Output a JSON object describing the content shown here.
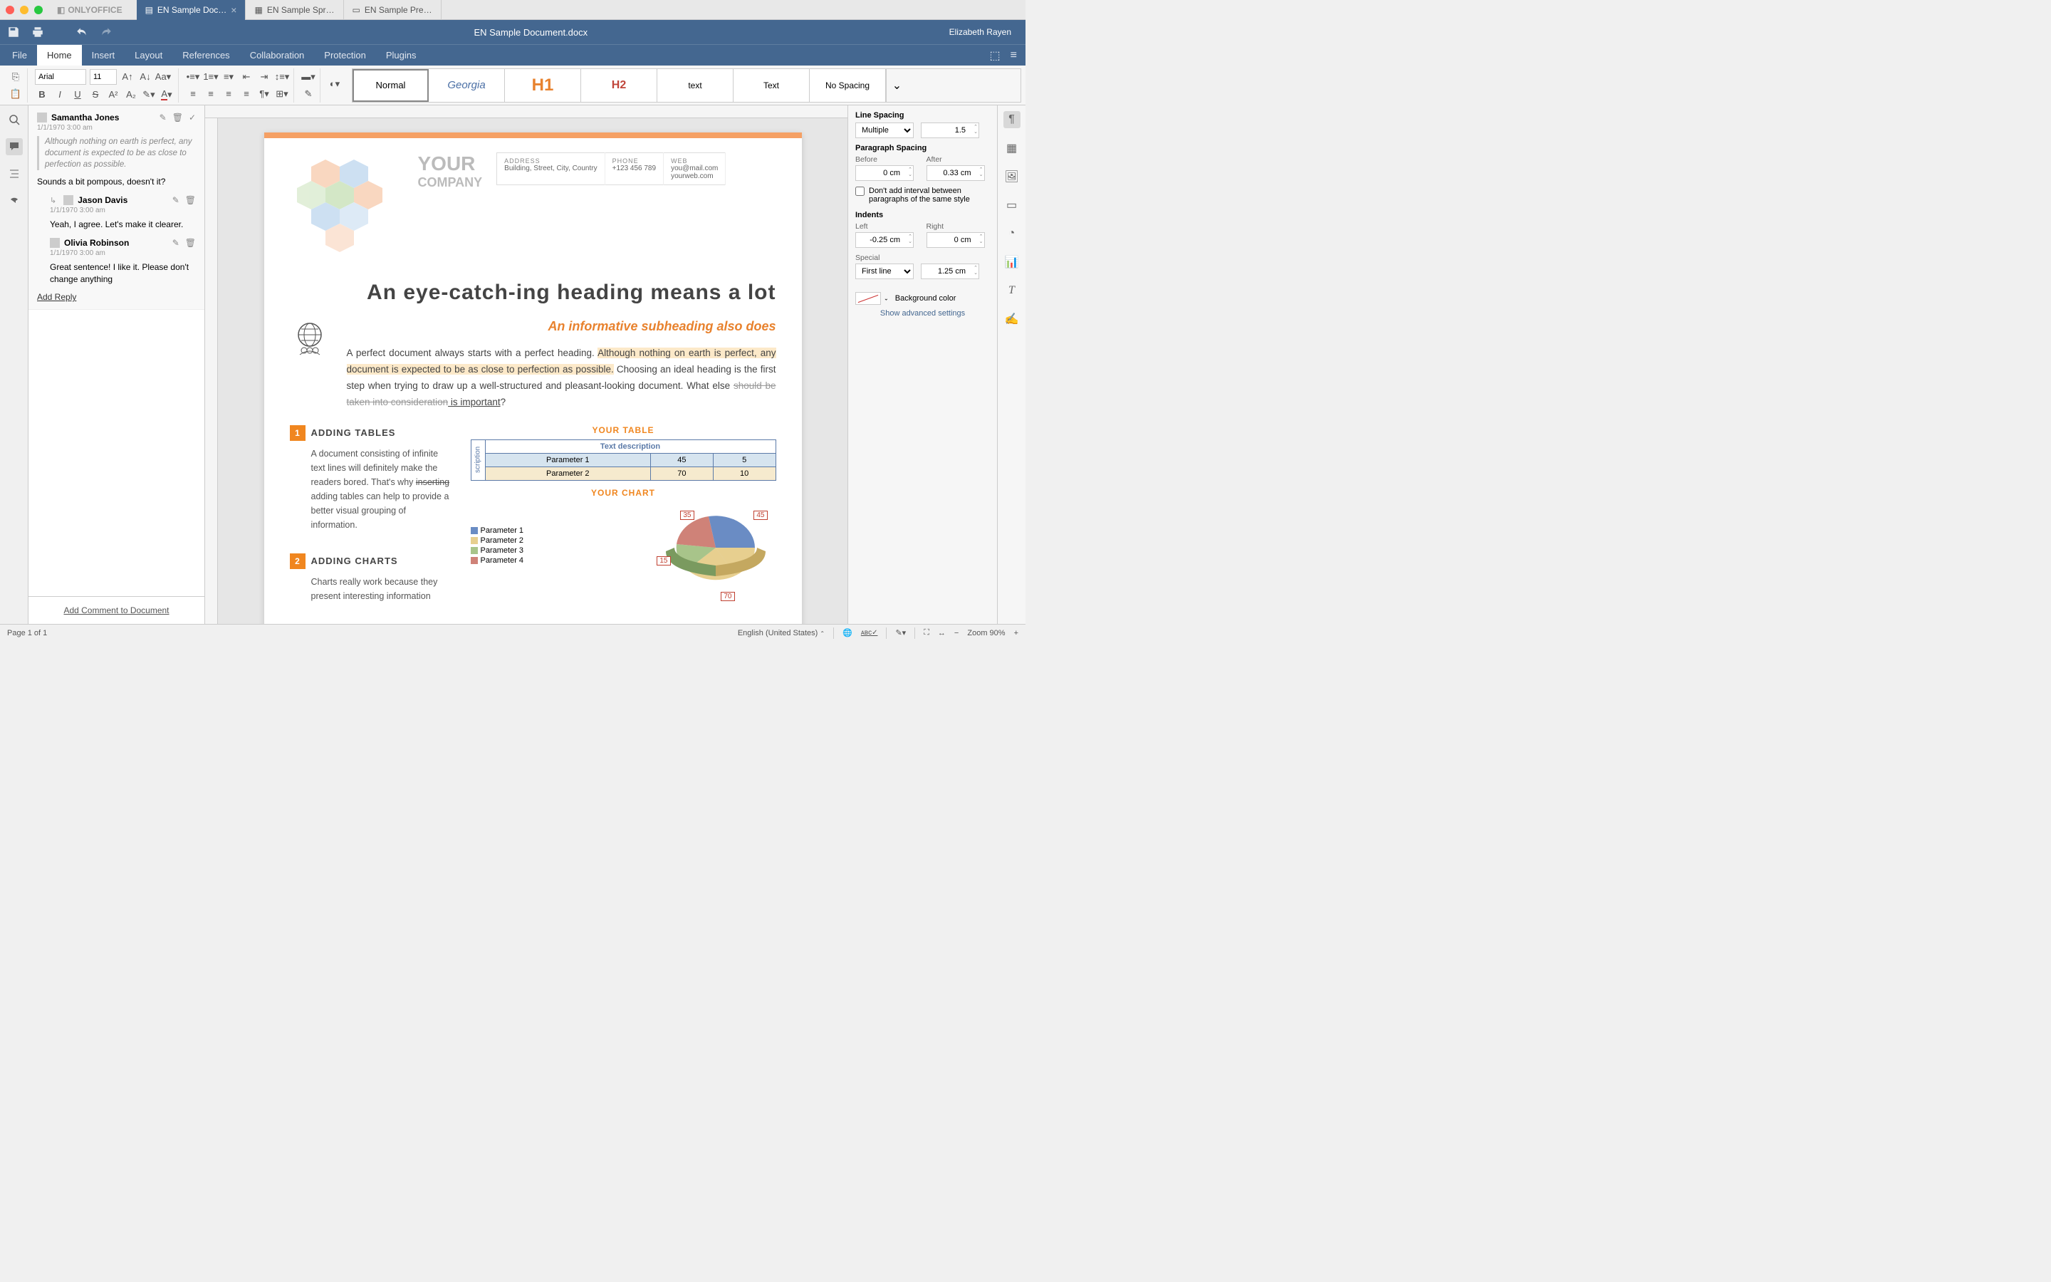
{
  "app_name": "ONLYOFFICE",
  "tabs": [
    {
      "label": "EN Sample Doc…",
      "active": true
    },
    {
      "label": "EN Sample Spr…",
      "active": false
    },
    {
      "label": "EN Sample Pre…",
      "active": false
    }
  ],
  "doc_title": "EN Sample Document.docx",
  "user": "Elizabeth Rayen",
  "menu": [
    "File",
    "Home",
    "Insert",
    "Layout",
    "References",
    "Collaboration",
    "Protection",
    "Plugins"
  ],
  "active_menu": "Home",
  "font": {
    "name": "Arial",
    "size": "11"
  },
  "styles": [
    {
      "label": "Normal",
      "class": ""
    },
    {
      "label": "Georgia",
      "class": "style-georgia"
    },
    {
      "label": "H1",
      "class": "style-h1"
    },
    {
      "label": "H2",
      "class": "style-h2"
    },
    {
      "label": "text",
      "class": ""
    },
    {
      "label": "Text",
      "class": ""
    },
    {
      "label": "No Spacing",
      "class": ""
    }
  ],
  "comments": {
    "main": {
      "author": "Samantha Jones",
      "time": "1/1/1970 3:00 am",
      "quote": "Although nothing on earth is perfect, any document is expected to be as close to perfection as possible.",
      "text": "Sounds a bit pompous, doesn't it?"
    },
    "replies": [
      {
        "author": "Jason Davis",
        "time": "1/1/1970 3:00 am",
        "text": "Yeah, I agree. Let's make it clearer."
      },
      {
        "author": "Olivia Robinson",
        "time": "1/1/1970 3:00 am",
        "text": "Great sentence! I like it. Please don't change anything"
      }
    ],
    "add_reply": "Add Reply",
    "add_comment": "Add Comment to Document"
  },
  "document": {
    "company_your": "YOUR",
    "company_company": "COMPANY",
    "address_lbl": "ADDRESS",
    "address_val": "Building, Street, City, Country",
    "phone_lbl": "PHONE",
    "phone_val": "+123 456 789",
    "web_lbl": "WEB",
    "web_val1": "you@mail.com",
    "web_val2": "yourweb.com",
    "h1": "An eye-catch-ing heading means a lot",
    "h2": "An informative subheading also does",
    "body_pre": "A perfect document always starts with a perfect heading. ",
    "body_hl": "Although nothing on earth is perfect, any document is expected to be as close to perfection as possible.",
    "body_post1": " Choosing an ideal heading is the first step when trying to draw up a well-structured and pleasant-looking document. What else ",
    "body_strike": "should be taken into consideration",
    "body_under": " is important",
    "body_end": "?",
    "sec1_num": "1",
    "sec1_title": "ADDING TABLES",
    "sec1_body_a": "A document consisting of infinite text lines will definitely make the readers bored. That's why ",
    "sec1_body_strike": "inserting",
    "sec1_body_b": " adding tables can help to provide a better visual grouping of information.",
    "sec2_num": "2",
    "sec2_title": "ADDING CHARTS",
    "sec2_body": "Charts really work because they present interesting information",
    "table_title": "YOUR TABLE",
    "table_desc": "Text description",
    "table_rot": "scription",
    "table_rows": [
      {
        "p": "Parameter 1",
        "a": "45",
        "b": "5"
      },
      {
        "p": "Parameter 2",
        "a": "70",
        "b": "10"
      }
    ],
    "chart_title": "YOUR CHART",
    "chart_legend": [
      "Parameter 1",
      "Parameter 2",
      "Parameter 3",
      "Parameter 4"
    ],
    "chart_labels": {
      "a": "35",
      "b": "45",
      "c": "15",
      "d": "70"
    }
  },
  "chart_data": {
    "type": "pie",
    "title": "YOUR CHART",
    "series": [
      {
        "name": "Parameter 1",
        "value": 45,
        "color": "#6a8cc4"
      },
      {
        "name": "Parameter 2",
        "value": 70,
        "color": "#e7cf8f"
      },
      {
        "name": "Parameter 3",
        "value": 15,
        "color": "#a8c48a"
      },
      {
        "name": "Parameter 4",
        "value": 35,
        "color": "#cf8278"
      }
    ],
    "labels_visible": [
      45,
      70,
      15,
      35
    ]
  },
  "right_panel": {
    "line_spacing_lbl": "Line Spacing",
    "line_spacing_mode": "Multiple",
    "line_spacing_val": "1.5",
    "para_spacing_lbl": "Paragraph Spacing",
    "before_lbl": "Before",
    "before_val": "0 cm",
    "after_lbl": "After",
    "after_val": "0.33 cm",
    "dont_add": "Don't add interval between paragraphs of the same style",
    "indents_lbl": "Indents",
    "left_lbl": "Left",
    "left_val": "-0.25 cm",
    "right_lbl": "Right",
    "right_val": "0 cm",
    "special_lbl": "Special",
    "special_mode": "First line",
    "special_val": "1.25 cm",
    "bg_color": "Background color",
    "advanced": "Show advanced settings"
  },
  "statusbar": {
    "page": "Page 1 of 1",
    "lang": "English (United States)",
    "zoom": "Zoom 90%"
  }
}
